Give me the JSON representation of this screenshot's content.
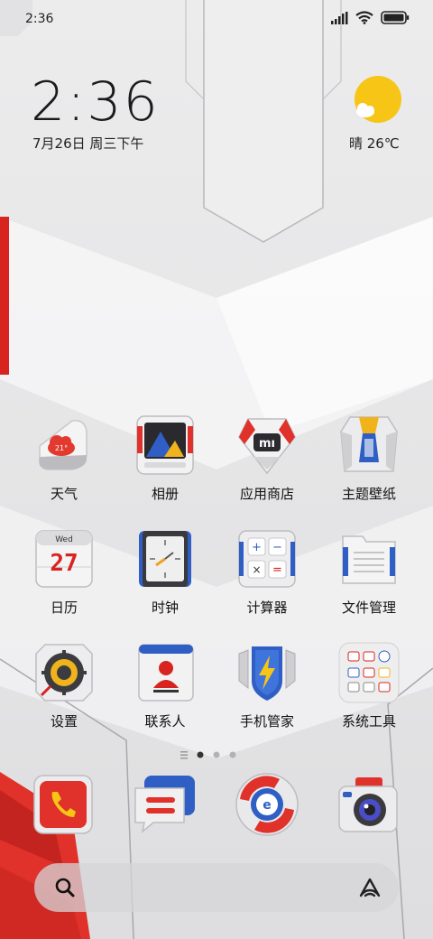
{
  "status_bar": {
    "time": "2:36"
  },
  "clock_widget": {
    "time": "2:36",
    "date": "7月26日 周三下午"
  },
  "weather_widget": {
    "condition_temp": "晴 26℃"
  },
  "apps": [
    {
      "label": "天气",
      "icon": "weather-icon"
    },
    {
      "label": "相册",
      "icon": "gallery-icon"
    },
    {
      "label": "应用商店",
      "icon": "app-store-icon"
    },
    {
      "label": "主题壁纸",
      "icon": "themes-icon"
    },
    {
      "label": "日历",
      "icon": "calendar-icon",
      "badge_day": "Wed",
      "badge_date": "27",
      "temp_text": "21°"
    },
    {
      "label": "时钟",
      "icon": "clock-icon"
    },
    {
      "label": "计算器",
      "icon": "calculator-icon"
    },
    {
      "label": "文件管理",
      "icon": "file-manager-icon"
    },
    {
      "label": "设置",
      "icon": "settings-icon"
    },
    {
      "label": "联系人",
      "icon": "contacts-icon"
    },
    {
      "label": "手机管家",
      "icon": "security-icon"
    },
    {
      "label": "系统工具",
      "icon": "tools-folder-icon"
    }
  ],
  "weather_app_temp": "21°",
  "calendar_day": "Wed",
  "calendar_date": "27",
  "page_indicator": {
    "pages": 3,
    "current": 1
  },
  "dock": [
    {
      "icon": "phone-icon"
    },
    {
      "icon": "messages-icon"
    },
    {
      "icon": "browser-icon"
    },
    {
      "icon": "camera-icon"
    }
  ],
  "colors": {
    "accent_red": "#e0312a",
    "accent_blue": "#2f5fc4",
    "sun": "#f6c516"
  }
}
